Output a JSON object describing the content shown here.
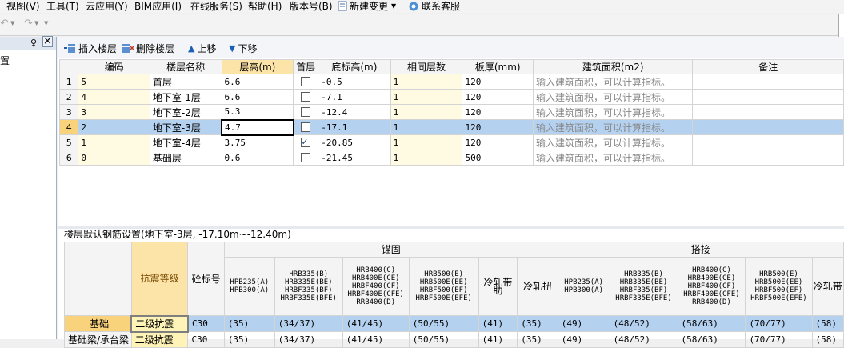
{
  "menu": [
    "视图(V)",
    "工具(T)",
    "云应用(Y)",
    "BIM应用(I)",
    "在线服务(S)",
    "帮助(H)",
    "版本号(B)",
    "新建变更",
    "联系客服"
  ],
  "left_panel": {
    "pin": "♀",
    "close": "×",
    "label": "置"
  },
  "toolbar2": {
    "insert": "插入楼层",
    "delete": "删除楼层",
    "up": "上移",
    "down": "下移"
  },
  "floor_table": {
    "headers": [
      "编码",
      "楼层名称",
      "层高(m)",
      "首层",
      "底标高(m)",
      "相同层数",
      "板厚(mm)",
      "建筑面积(m2)",
      "备注"
    ],
    "rows": [
      {
        "n": "1",
        "code": "5",
        "name": "首层",
        "height": "6.6",
        "first": false,
        "bottom": "-0.5",
        "same": "1",
        "thick": "120",
        "area": "输入建筑面积，可以计算指标。",
        "note": ""
      },
      {
        "n": "2",
        "code": "4",
        "name": "地下室-1层",
        "height": "6.6",
        "first": false,
        "bottom": "-7.1",
        "same": "1",
        "thick": "120",
        "area": "输入建筑面积，可以计算指标。",
        "note": ""
      },
      {
        "n": "3",
        "code": "3",
        "name": "地下室-2层",
        "height": "5.3",
        "first": false,
        "bottom": "-12.4",
        "same": "1",
        "thick": "120",
        "area": "输入建筑面积，可以计算指标。",
        "note": ""
      },
      {
        "n": "4",
        "code": "2",
        "name": "地下室-3层",
        "height": "4.7",
        "first": false,
        "bottom": "-17.1",
        "same": "1",
        "thick": "120",
        "area": "输入建筑面积，可以计算指标。",
        "note": ""
      },
      {
        "n": "5",
        "code": "1",
        "name": "地下室-4层",
        "height": "3.75",
        "first": true,
        "bottom": "-20.85",
        "same": "1",
        "thick": "120",
        "area": "输入建筑面积，可以计算指标。",
        "note": ""
      },
      {
        "n": "6",
        "code": "0",
        "name": "基础层",
        "height": "0.6",
        "first": false,
        "bottom": "-21.45",
        "same": "1",
        "thick": "500",
        "area": "输入建筑面积，可以计算指标。",
        "note": ""
      }
    ],
    "selected_row": 3
  },
  "rebar": {
    "title": "楼层默认钢筋设置(地下室-3层, -17.10m~-12.40m)",
    "group_anchor": "锚固",
    "group_lap": "搭接",
    "col_seismic": "抗震等级",
    "col_concrete": "砼标号",
    "cols": [
      "HPB235(A)\nHPB300(A)",
      "HRB335(B)\nHRB335E(BE)\nHRBF335(BF)\nHRBF335E(BFE)",
      "HRB400(C)\nHRB400E(CE)\nHRBF400(CF)\nHRBF400E(CFE)\nRRB400(D)",
      "HRB500(E)\nHRB500E(EE)\nHRBF500(EF)\nHRBF500E(EFE)",
      "冷轧带肋",
      "冷轧扭",
      "HPB235(A)\nHPB300(A)",
      "HRB335(B)\nHRB335E(BE)\nHRBF335(BF)\nHRBF335E(BFE)",
      "HRB400(C)\nHRB400E(CE)\nHRBF400(CF)\nHRBF400E(CFE)\nRRB400(D)",
      "HRB500(E)\nHRB500E(EE)\nHRBF500(EF)\nHRBF500E(EFE)",
      "冷轧带"
    ],
    "rows": [
      {
        "label": "基础",
        "seismic": "二级抗震",
        "concrete": "C30",
        "vals": [
          "(35)",
          "(34/37)",
          "(41/45)",
          "(50/55)",
          "(41)",
          "(35)",
          "(49)",
          "(48/52)",
          "(58/63)",
          "(70/77)",
          "(58)"
        ]
      },
      {
        "label": "基础梁/承台梁",
        "seismic": "二级抗震",
        "concrete": "C30",
        "vals": [
          "(35)",
          "(34/37)",
          "(41/45)",
          "(50/55)",
          "(41)",
          "(35)",
          "(49)",
          "(48/52)",
          "(58/63)",
          "(70/77)",
          "(58)"
        ]
      }
    ]
  }
}
